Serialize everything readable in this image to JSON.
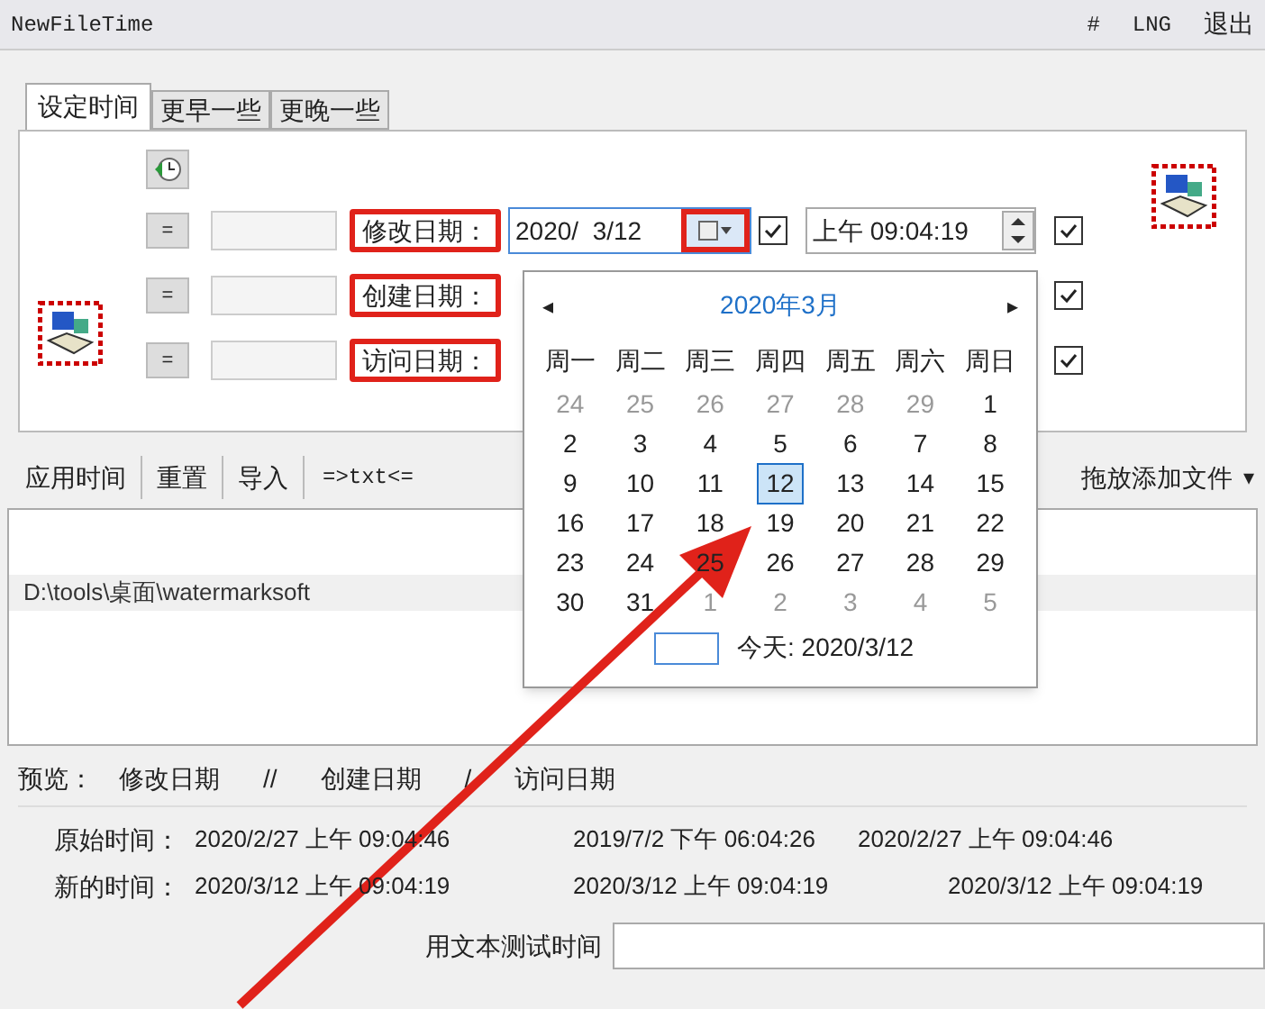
{
  "title_bar": {
    "title": "NewFileTime",
    "menu": [
      "#",
      "LNG",
      "退出"
    ]
  },
  "tabs": [
    {
      "label": "设定时间",
      "selected": true
    },
    {
      "label": "更早一些",
      "selected": false
    },
    {
      "label": "更晚一些",
      "selected": false
    }
  ],
  "date_rows": [
    {
      "button": "=",
      "label": "修改日期：",
      "date": "2020/  3/12",
      "date_checked": true,
      "time": "上午 09:04:19",
      "time_checked": true
    },
    {
      "button": "=",
      "label": "创建日期：",
      "time_checked": true
    },
    {
      "button": "=",
      "label": "访问日期：",
      "time_checked": true
    }
  ],
  "toolbar": {
    "buttons": [
      "应用时间",
      "重置",
      "导入",
      "=>txt<="
    ],
    "drop": "拖放添加文件",
    "caret": "▾"
  },
  "file_list": [
    "D:\\tools\\桌面\\watermarksoft"
  ],
  "calendar": {
    "prev": "◂",
    "next": "▸",
    "month": "2020年3月",
    "weekdays": [
      "周一",
      "周二",
      "周三",
      "周四",
      "周五",
      "周六",
      "周日"
    ],
    "days": [
      {
        "label": "24",
        "kind": "other",
        "selected": false
      },
      {
        "label": "25",
        "kind": "other",
        "selected": false
      },
      {
        "label": "26",
        "kind": "other",
        "selected": false
      },
      {
        "label": "27",
        "kind": "other",
        "selected": false
      },
      {
        "label": "28",
        "kind": "other",
        "selected": false
      },
      {
        "label": "29",
        "kind": "other",
        "selected": false
      },
      {
        "label": "1",
        "kind": "current",
        "selected": false
      },
      {
        "label": "2",
        "kind": "current",
        "selected": false
      },
      {
        "label": "3",
        "kind": "current",
        "selected": false
      },
      {
        "label": "4",
        "kind": "current",
        "selected": false
      },
      {
        "label": "5",
        "kind": "current",
        "selected": false
      },
      {
        "label": "6",
        "kind": "current",
        "selected": false
      },
      {
        "label": "7",
        "kind": "current",
        "selected": false
      },
      {
        "label": "8",
        "kind": "current",
        "selected": false
      },
      {
        "label": "9",
        "kind": "current",
        "selected": false
      },
      {
        "label": "10",
        "kind": "current",
        "selected": false
      },
      {
        "label": "11",
        "kind": "current",
        "selected": false
      },
      {
        "label": "12",
        "kind": "current",
        "selected": true
      },
      {
        "label": "13",
        "kind": "current",
        "selected": false
      },
      {
        "label": "14",
        "kind": "current",
        "selected": false
      },
      {
        "label": "15",
        "kind": "current",
        "selected": false
      },
      {
        "label": "16",
        "kind": "current",
        "selected": false
      },
      {
        "label": "17",
        "kind": "current",
        "selected": false
      },
      {
        "label": "18",
        "kind": "current",
        "selected": false
      },
      {
        "label": "19",
        "kind": "current",
        "selected": false
      },
      {
        "label": "20",
        "kind": "current",
        "selected": false
      },
      {
        "label": "21",
        "kind": "current",
        "selected": false
      },
      {
        "label": "22",
        "kind": "current",
        "selected": false
      },
      {
        "label": "23",
        "kind": "current",
        "selected": false
      },
      {
        "label": "24",
        "kind": "current",
        "selected": false
      },
      {
        "label": "25",
        "kind": "current",
        "selected": false
      },
      {
        "label": "26",
        "kind": "current",
        "selected": false
      },
      {
        "label": "27",
        "kind": "current",
        "selected": false
      },
      {
        "label": "28",
        "kind": "current",
        "selected": false
      },
      {
        "label": "29",
        "kind": "current",
        "selected": false
      },
      {
        "label": "30",
        "kind": "current",
        "selected": false
      },
      {
        "label": "31",
        "kind": "current",
        "selected": false
      },
      {
        "label": "1",
        "kind": "other",
        "selected": false
      },
      {
        "label": "2",
        "kind": "other",
        "selected": false
      },
      {
        "label": "3",
        "kind": "other",
        "selected": false
      },
      {
        "label": "4",
        "kind": "other",
        "selected": false
      },
      {
        "label": "5",
        "kind": "other",
        "selected": false
      }
    ],
    "today": "今天: 2020/3/12"
  },
  "preview": {
    "label": "预览：",
    "columns": [
      "修改日期",
      "//",
      "创建日期",
      "/",
      "访问日期"
    ],
    "rows": [
      {
        "label": "原始时间：",
        "values": [
          "2020/2/27 上午 09:04:46",
          "2019/7/2 下午 06:04:26",
          "2020/2/27 上午 09:04:46"
        ]
      },
      {
        "label": "新的时间：",
        "values": [
          "2020/3/12 上午 09:04:19",
          "2020/3/12 上午 09:04:19",
          "2020/3/12 上午 09:04:19"
        ]
      }
    ]
  },
  "test_field": {
    "label": "用文本测试时间"
  }
}
